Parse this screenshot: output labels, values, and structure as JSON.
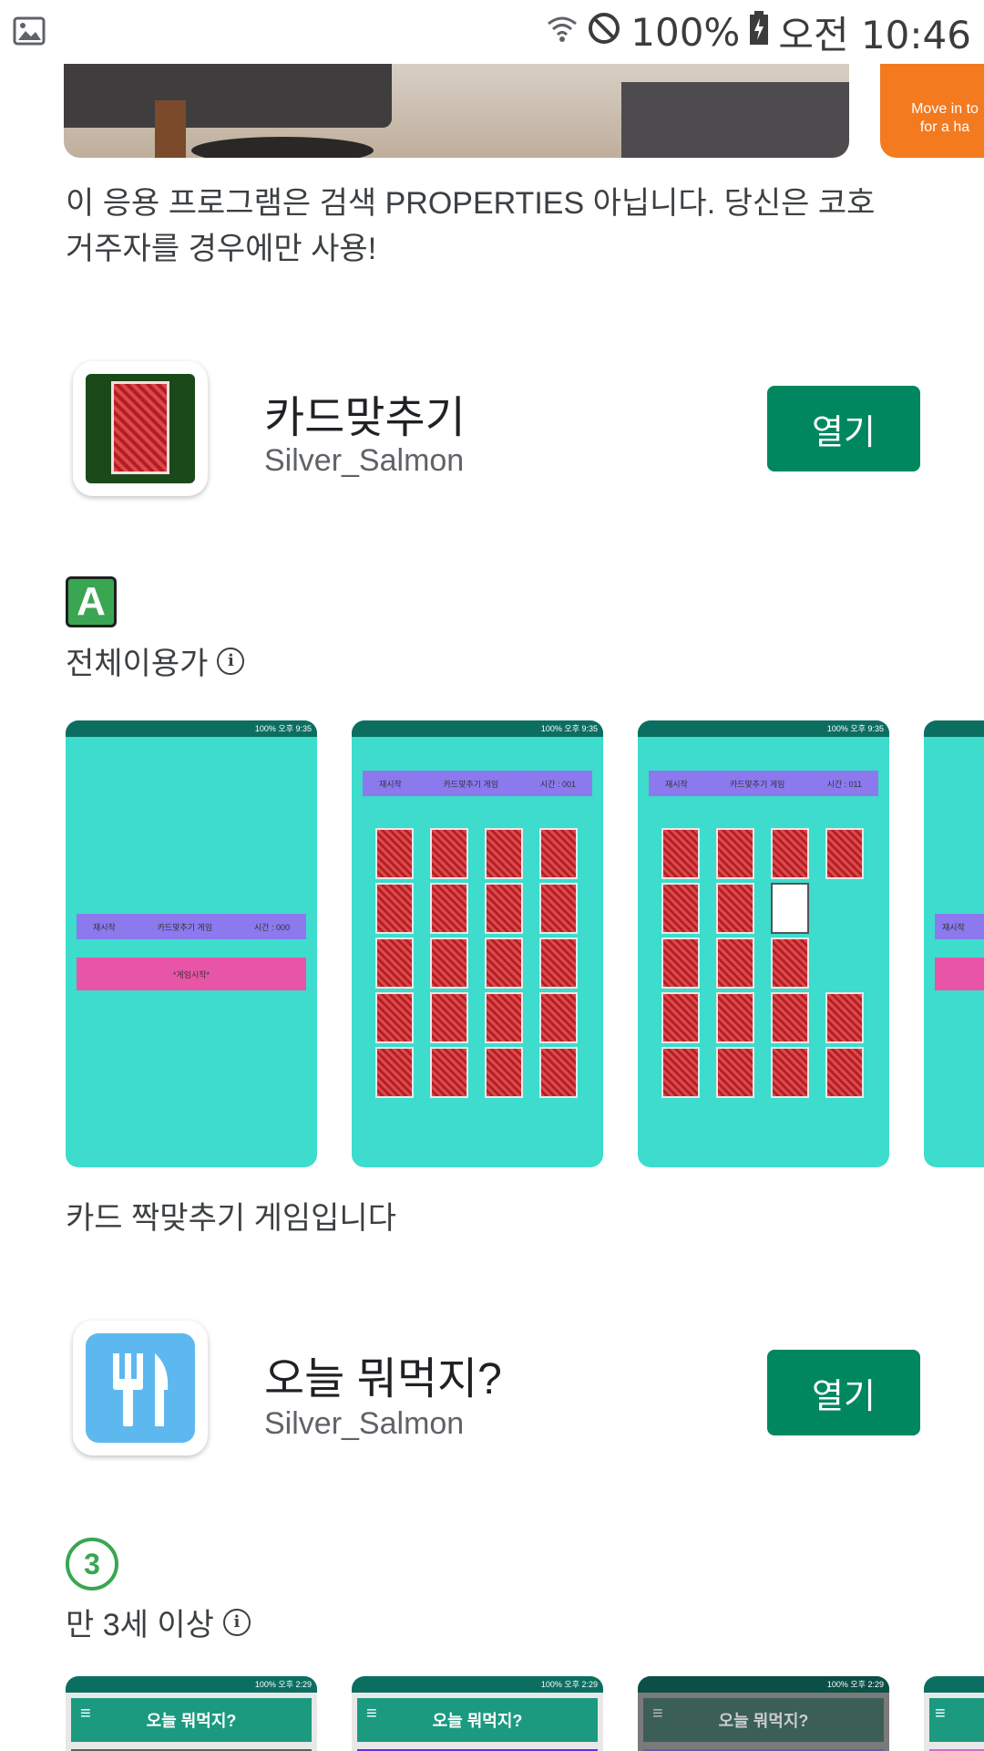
{
  "status_bar": {
    "battery": "100%",
    "time": "오전 10:46"
  },
  "banner": {
    "partial_text": "Move in to\nfor a ha"
  },
  "top_description": "이 응용 프로그램은 검색 PROPERTIES 아닙니다. 당신은 코호 거주자를 경우에만 사용!",
  "apps": [
    {
      "title": "카드맞추기",
      "developer": "Silver_Salmon",
      "open_label": "열기",
      "rating_badge": "A",
      "rating_label": "전체이용가",
      "description": "카드 짝맞추기 게임입니다",
      "screenshots": [
        {
          "bar": [
            "재시작",
            "카드맞추기 게임",
            "시간 : 000"
          ],
          "start_label": "*게임시작*",
          "status": "100% 오후 9:35"
        },
        {
          "bar": [
            "재시작",
            "카드맞추기 게임",
            "시간 : 001"
          ],
          "status": "100% 오후 9:35"
        },
        {
          "bar": [
            "재시작",
            "카드맞추기 게임",
            "시간 : 011"
          ],
          "status": "100% 오후 9:35"
        },
        {
          "bar": [
            "재시작"
          ],
          "status": ""
        }
      ]
    },
    {
      "title": "오늘 뭐먹지?",
      "developer": "Silver_Salmon",
      "open_label": "열기",
      "rating_badge": "3",
      "rating_label": "만 3세 이상",
      "screenshots": [
        {
          "header": "오늘 뭐먹지?",
          "status": "100% 오후 2:29",
          "bottom_color": "#5e5e5e"
        },
        {
          "header": "오늘 뭐먹지?",
          "status": "100% 오후 2:29",
          "bottom_color": "#6a2bd9"
        },
        {
          "header": "오늘 뭐먹지?",
          "status": "100% 오후 2:29",
          "bottom_color": "#6a5aa0"
        },
        {
          "header": "",
          "status": "",
          "bottom_color": "#d070c0"
        }
      ]
    }
  ],
  "colors": {
    "open_button": "#01875f",
    "screenshot_bg": "#3ddccc",
    "rating_green": "#3aa652"
  }
}
